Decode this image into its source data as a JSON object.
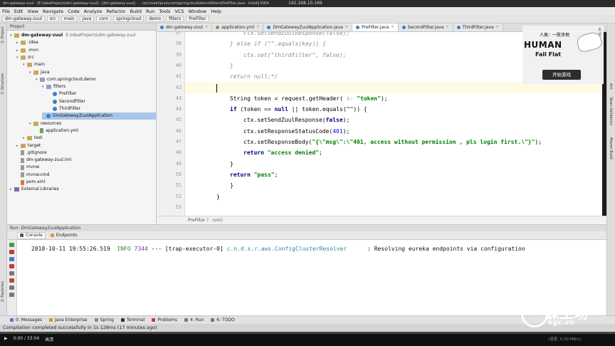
{
  "window": {
    "title": "dm-gateway-zuul - [E:\\ideaProjects\\dm-gateway-zuul] - [dm-gateway-zuul] - ...\\src\\main\\java\\com\\springcloud\\demo\\filters\\PreFilter.java - IntelliJ IDEA",
    "remote_ip": "192.168.10.169"
  },
  "menu": [
    "File",
    "Edit",
    "View",
    "Navigate",
    "Code",
    "Analyze",
    "Refactor",
    "Build",
    "Run",
    "Tools",
    "VCS",
    "Window",
    "Help"
  ],
  "nav_crumbs": [
    "dm-gateway-zuul",
    "src",
    "main",
    "java",
    "com",
    "springcloud",
    "demo",
    "filters",
    "PreFilter"
  ],
  "project": {
    "header": "Project",
    "tree": [
      {
        "label": "dm-gateway-zuul",
        "path": "E:\\ideaProjects\\dm-gateway-zuul",
        "icon": "folder-icon",
        "depth": 0,
        "twisty": "▾",
        "bold": true
      },
      {
        "label": ".idea",
        "icon": "folder-icon",
        "depth": 1,
        "twisty": "▸"
      },
      {
        "label": ".mvn",
        "icon": "folder-icon",
        "depth": 1,
        "twisty": "▸"
      },
      {
        "label": "src",
        "icon": "folder-icon",
        "depth": 1,
        "twisty": "▾"
      },
      {
        "label": "main",
        "icon": "folder-icon",
        "depth": 2,
        "twisty": "▾"
      },
      {
        "label": "java",
        "icon": "folder-icon",
        "depth": 3,
        "twisty": "▾"
      },
      {
        "label": "com.springcloud.demo",
        "icon": "package-icon",
        "depth": 4,
        "twisty": "▾"
      },
      {
        "label": "filters",
        "icon": "package-icon",
        "depth": 5,
        "twisty": "▾"
      },
      {
        "label": "PreFilter",
        "icon": "class-icon",
        "depth": 6,
        "twisty": ""
      },
      {
        "label": "SecondFilter",
        "icon": "class-icon",
        "depth": 6,
        "twisty": ""
      },
      {
        "label": "ThirdFilter",
        "icon": "class-icon",
        "depth": 6,
        "twisty": ""
      },
      {
        "label": "DmGatewayZuulApplication",
        "icon": "class-icon",
        "depth": 5,
        "twisty": "",
        "selected": true
      },
      {
        "label": "resources",
        "icon": "folder-icon",
        "depth": 3,
        "twisty": "▾"
      },
      {
        "label": "application.yml",
        "icon": "yml-file-icon",
        "depth": 4,
        "twisty": ""
      },
      {
        "label": "test",
        "icon": "folder-icon",
        "depth": 2,
        "twisty": "▸"
      },
      {
        "label": "target",
        "icon": "folder-icon",
        "depth": 1,
        "twisty": "▸"
      },
      {
        "label": ".gitignore",
        "icon": "file-icon",
        "depth": 1,
        "twisty": ""
      },
      {
        "label": "dm-gateway-zuul.iml",
        "icon": "file-icon",
        "depth": 1,
        "twisty": ""
      },
      {
        "label": "mvnw",
        "icon": "file-icon",
        "depth": 1,
        "twisty": ""
      },
      {
        "label": "mvnw.cmd",
        "icon": "file-icon",
        "depth": 1,
        "twisty": ""
      },
      {
        "label": "pom.xml",
        "icon": "xml-file-icon",
        "depth": 1,
        "twisty": ""
      },
      {
        "label": "External Libraries",
        "icon": "library-icon",
        "depth": 0,
        "twisty": "▸"
      }
    ]
  },
  "editor_tabs": [
    {
      "label": "dm-gateway-zuul",
      "color": "#3b7fc4"
    },
    {
      "label": "application.yml",
      "color": "#6fa34f"
    },
    {
      "label": "DmGatewayZuulApplication.java",
      "color": "#3b7fc4"
    },
    {
      "label": "PreFilter.java",
      "color": "#3b7fc4",
      "active": true
    },
    {
      "label": "SecondFilter.java",
      "color": "#3b7fc4"
    },
    {
      "label": "ThirdFilter.java",
      "color": "#3b7fc4"
    }
  ],
  "code_lines": [
    {
      "n": "37",
      "indent": 2,
      "style": "comment",
      "text": "ctx.setSendZuulResponse(false);"
    },
    {
      "n": "38",
      "indent": 1,
      "style": "comment",
      "text": "} else if (\"\".equals(key)) {"
    },
    {
      "n": "39",
      "indent": 2,
      "style": "comment",
      "text": "ctx.set(\"thirdfilter\", false);"
    },
    {
      "n": "40",
      "indent": 1,
      "style": "comment",
      "text": "}"
    },
    {
      "n": "41",
      "indent": 1,
      "style": "comment",
      "text": "return null;*/"
    },
    {
      "n": "42",
      "indent": 0,
      "style": "plain",
      "text": ""
    },
    {
      "n": "43",
      "indent": 1,
      "style": "mixed",
      "parts": [
        [
          "plain",
          "String token = request.getHeader( "
        ],
        [
          "mute",
          "s: "
        ],
        [
          "str",
          "\"token\""
        ],
        [
          "plain",
          ");"
        ]
      ]
    },
    {
      "n": "44",
      "indent": 1,
      "style": "mixed",
      "parts": [
        [
          "kw",
          "if"
        ],
        [
          "plain",
          " (token == "
        ],
        [
          "kw",
          "null"
        ],
        [
          "plain",
          " || token.equals("
        ],
        [
          "str",
          "\"\""
        ],
        [
          "plain",
          ")) {"
        ]
      ]
    },
    {
      "n": "45",
      "indent": 2,
      "style": "mixed",
      "parts": [
        [
          "plain",
          "ctx.setSendZuulResponse("
        ],
        [
          "kw",
          "false"
        ],
        [
          "plain",
          ");"
        ]
      ]
    },
    {
      "n": "46",
      "indent": 2,
      "style": "mixed",
      "parts": [
        [
          "plain",
          "ctx.setResponseStatusCode("
        ],
        [
          "num",
          "401"
        ],
        [
          "plain",
          ");"
        ]
      ]
    },
    {
      "n": "47",
      "indent": 2,
      "style": "mixed",
      "parts": [
        [
          "plain",
          "ctx.setResponseBody("
        ],
        [
          "str",
          "\"{\\\"msg\\\":\\\"401, access without permission , pls login first.\\\"}\""
        ],
        [
          "plain",
          ");"
        ]
      ]
    },
    {
      "n": "48",
      "indent": 2,
      "style": "mixed",
      "parts": [
        [
          "kw",
          "return"
        ],
        [
          "plain",
          " "
        ],
        [
          "str",
          "\"access denied\""
        ],
        [
          "plain",
          ";"
        ]
      ]
    },
    {
      "n": "49",
      "indent": 1,
      "style": "plain",
      "text": "}"
    },
    {
      "n": "50",
      "indent": 1,
      "style": "mixed",
      "parts": [
        [
          "kw",
          "return"
        ],
        [
          "plain",
          " "
        ],
        [
          "str",
          "\"pass\""
        ],
        [
          "plain",
          ";"
        ]
      ]
    },
    {
      "n": "51",
      "indent": 0,
      "style": "plain",
      "text": "    }"
    },
    {
      "n": "52",
      "indent": 0,
      "style": "plain",
      "text": "}"
    },
    {
      "n": "53",
      "indent": 0,
      "style": "plain",
      "text": ""
    }
  ],
  "editor_breadcrumb": "PreFilter  〉  run()",
  "run_panel": {
    "header": "Run:  DmGatewayZuulApplication",
    "tabs": [
      "Console",
      "Endpoints"
    ],
    "log": {
      "timestamp": "2018-10-11 19:55:26.519",
      "level": "INFO",
      "pid": "7344",
      "sep": "---",
      "thread": "[trap-executor-0]",
      "logger": "c.n.d.s.r.aws.ConfigClusterResolver",
      "message": ": Resolving eureka endpoints via configuration"
    }
  },
  "left_strip_labels": [
    "1: Project",
    "2: Structure",
    "2: Favorites"
  ],
  "right_strip_labels": [
    "Ant",
    "Bean Validation",
    "Maven Build"
  ],
  "bottom_tabs": [
    "0: Messages",
    "Java Enterprise",
    "Spring",
    "Terminal",
    "Problems",
    "4: Run",
    "6: TODO"
  ],
  "status": "Compilation completed successfully in 1s 128ms (17 minutes ago)",
  "video": {
    "time": "0:00 / 33:04",
    "label": "高清",
    "progress": 0.0,
    "right_text": "(速度: 0.00 MB/s)"
  },
  "ad": {
    "subtitle": "人类：一败涂地",
    "title": "HUMAN",
    "title2": "Fall Flat",
    "button": "开始游戏",
    "close": "关闭"
  },
  "watermark": {
    "main": "课工场",
    "sub": "kgc.cn"
  }
}
